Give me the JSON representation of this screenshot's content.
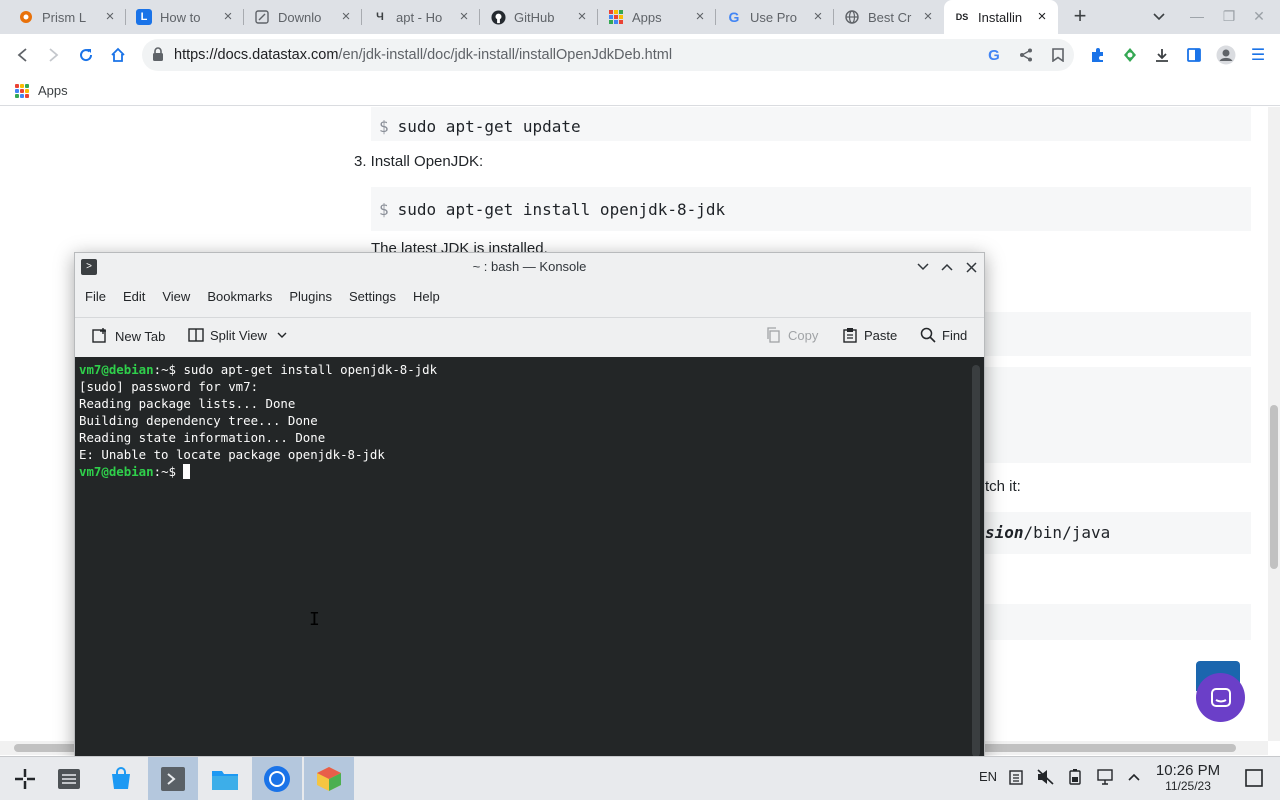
{
  "browser": {
    "tabs": [
      {
        "label": "Prism L",
        "icon": "prism-favicon-icon",
        "color": "#e8710a"
      },
      {
        "label": "How to",
        "icon": "linuxize-favicon-icon",
        "color": "#1a73e8"
      },
      {
        "label": "Downlo",
        "icon": "page-favicon-icon",
        "color": "#5f6368"
      },
      {
        "label": "apt - Ho",
        "icon": "askubuntu-favicon-icon",
        "color": "#3c4043"
      },
      {
        "label": "GitHub",
        "icon": "github-favicon-icon",
        "color": "#24292f"
      },
      {
        "label": "Apps",
        "icon": "apps-favicon-icon",
        "color": "#4285f4"
      },
      {
        "label": "Use Pro",
        "icon": "google-favicon-icon",
        "color": "#4285f4"
      },
      {
        "label": "Best Cr",
        "icon": "globe-favicon-icon",
        "color": "#5f6368"
      },
      {
        "label": "Installin",
        "icon": "datastax-favicon-icon",
        "color": "#202124",
        "fav_text": "DS"
      }
    ],
    "url_domain": "https://docs.datastax.com",
    "url_path": "/en/jdk-install/doc/jdk-install/installOpenJdkDeb.html",
    "bookmarks": {
      "apps_label": "Apps"
    }
  },
  "page": {
    "cmd1": "sudo apt-get update",
    "step3": "3. Install OpenJDK:",
    "cmd2": "sudo apt-get install openjdk-8-jdk",
    "note": "The latest JDK is installed.",
    "frag_text": "tch it:",
    "frag_code_italic": "sion",
    "frag_code_rest": "/bin/java",
    "dollar": "$"
  },
  "konsole": {
    "title": "~ : bash — Konsole",
    "menu": [
      "File",
      "Edit",
      "View",
      "Bookmarks",
      "Plugins",
      "Settings",
      "Help"
    ],
    "toolbar": {
      "new_tab": "New Tab",
      "split_view": "Split View",
      "copy": "Copy",
      "paste": "Paste",
      "find": "Find"
    },
    "terminal": {
      "prompt": "vm7@debian",
      "prompt_suffix": ":~$",
      "command": " sudo apt-get install openjdk-8-jdk",
      "output": [
        "[sudo] password for vm7:",
        "Reading package lists... Done",
        "Building dependency tree... Done",
        "Reading state information... Done",
        "E: Unable to locate package openjdk-8-jdk"
      ]
    }
  },
  "taskbar": {
    "language": "EN",
    "time": "10:26 PM",
    "date": "11/25/23"
  }
}
